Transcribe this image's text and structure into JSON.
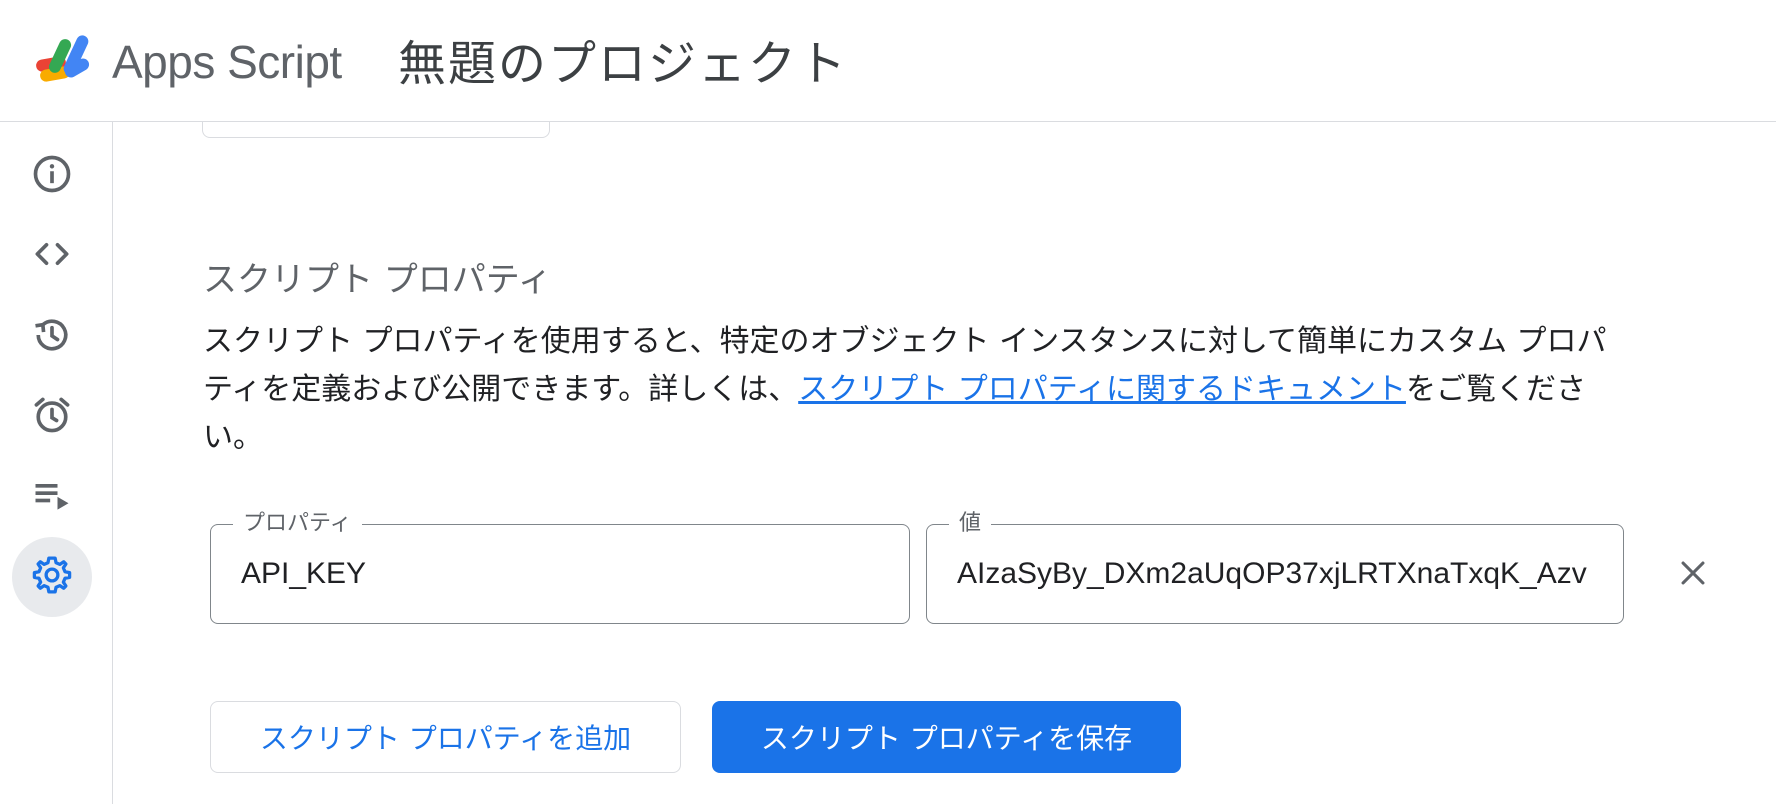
{
  "header": {
    "app_name": "Apps Script",
    "project_title": "無題のプロジェクト"
  },
  "rail": {
    "items": [
      {
        "name": "overview",
        "icon": "info-icon"
      },
      {
        "name": "editor",
        "icon": "code-icon"
      },
      {
        "name": "executions-history",
        "icon": "history-icon"
      },
      {
        "name": "triggers",
        "icon": "alarm-icon"
      },
      {
        "name": "executions",
        "icon": "playlist-play-icon"
      },
      {
        "name": "project-settings",
        "icon": "gear-icon",
        "active": true
      }
    ]
  },
  "script_properties": {
    "title": "スクリプト プロパティ",
    "description_before": "スクリプト プロパティを使用すると、特定のオブジェクト インスタンスに対して簡単にカスタム プロパティを定義および公開できます。詳しくは、",
    "doc_link": "スクリプト プロパティに関するドキュメント",
    "description_after": "をご覧ください。",
    "property_label": "プロパティ",
    "property_value": "API_KEY",
    "value_label": "値",
    "value_value": "AIzaSyBy_DXm2aUqOP37xjLRTXnaTxqK_Azv",
    "add_button": "スクリプト プロパティを追加",
    "save_button": "スクリプト プロパティを保存"
  },
  "colors": {
    "accent": "#1a73e8",
    "rail_active_bg": "#e8eaed",
    "icon": "#5f6368"
  }
}
